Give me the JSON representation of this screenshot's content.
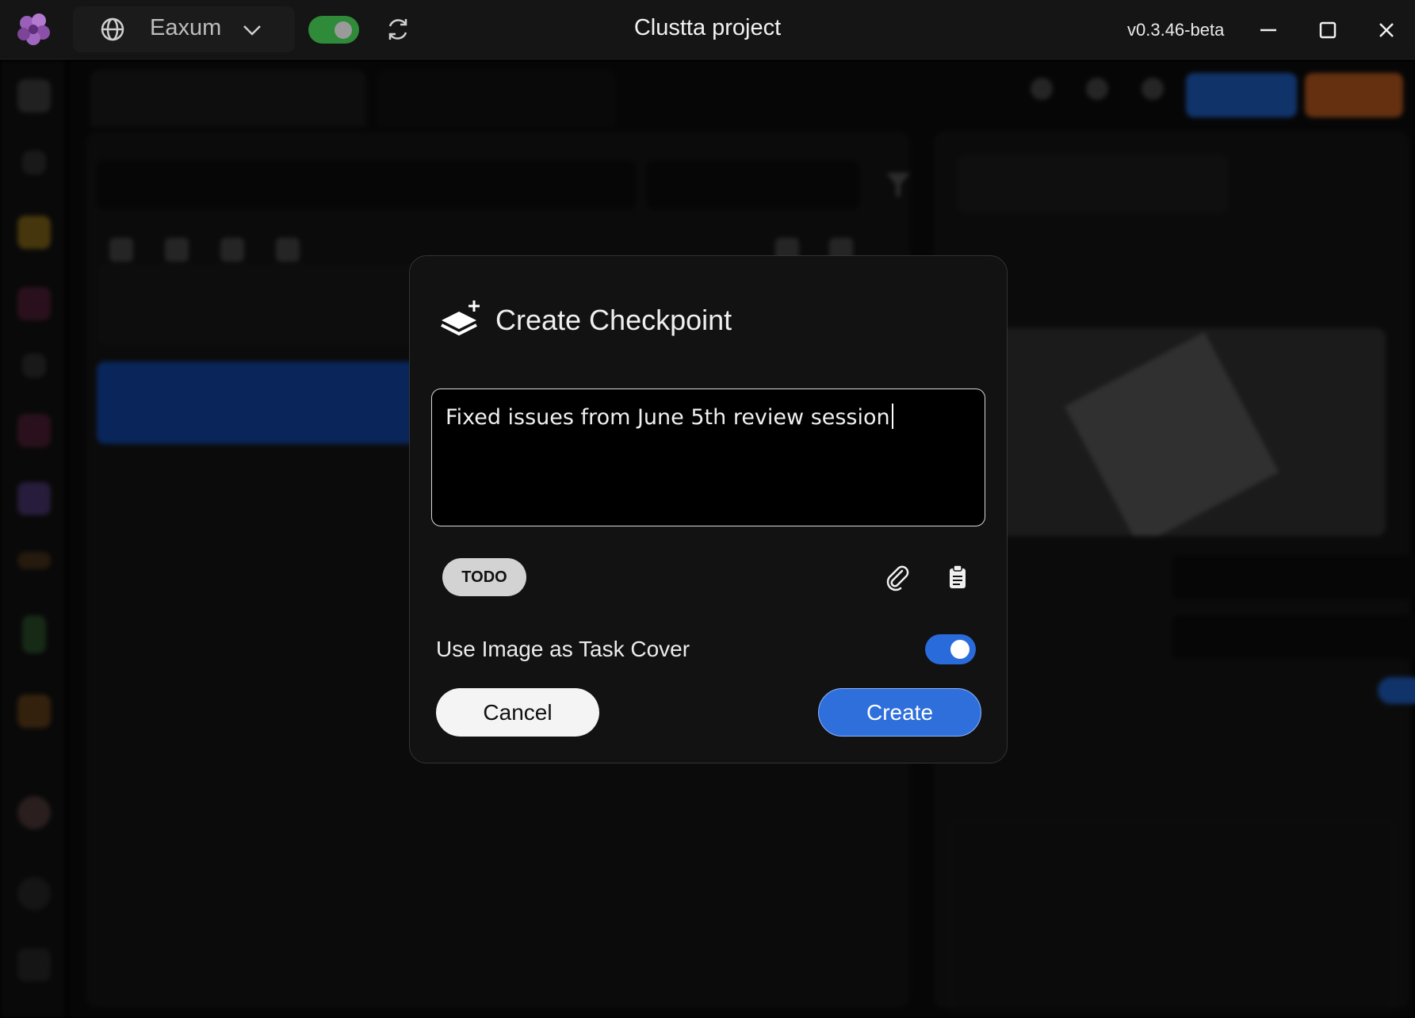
{
  "titlebar": {
    "workspace": "Eaxum",
    "title": "Clustta project",
    "version": "v0.3.46-beta",
    "online": true
  },
  "colors": {
    "accent": "#2e6fdb",
    "online_green": "#2f8a3a",
    "modal_bg": "#121212"
  },
  "icons": {
    "logo": "clustta-flower-icon",
    "workspace": "globe-icon",
    "sync": "refresh-icon",
    "modal": "layers-plus-icon",
    "attach": "paperclip-icon",
    "paste": "clipboard-icon"
  },
  "modal": {
    "title": "Create Checkpoint",
    "message": "Fixed issues from June 5th review session",
    "status_chip": "TODO",
    "cover_label": "Use Image as Task Cover",
    "cover_enabled": true,
    "cancel_label": "Cancel",
    "create_label": "Create"
  }
}
